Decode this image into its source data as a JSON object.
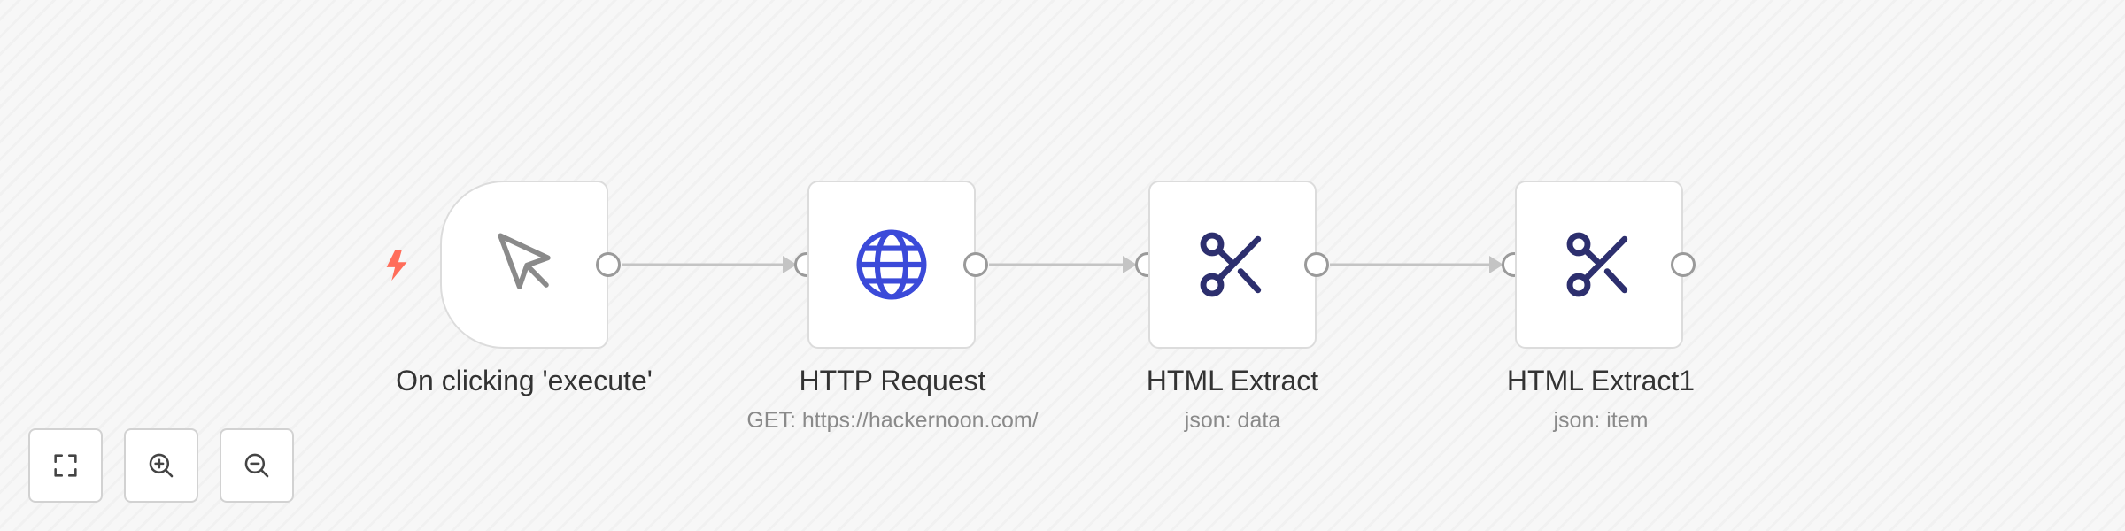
{
  "canvas": {
    "nodes": [
      {
        "title": "On clicking 'execute'",
        "subtitle": "",
        "icon": "cursor-icon",
        "icon_color": "#8a8a8a",
        "trigger_icon": "lightning-icon",
        "trigger_color": "#ff6d5a"
      },
      {
        "title": "HTTP Request",
        "subtitle": "GET: https://hackernoon.com/",
        "icon": "globe-icon",
        "icon_color": "#3b4ad9"
      },
      {
        "title": "HTML Extract",
        "subtitle": "json: data",
        "icon": "scissors-icon",
        "icon_color": "#2d2f6e"
      },
      {
        "title": "HTML Extract1",
        "subtitle": "json: item",
        "icon": "scissors-icon",
        "icon_color": "#2d2f6e"
      }
    ],
    "connection_color": "#c4c4c4"
  },
  "controls": [
    {
      "icon": "fit-to-view-icon"
    },
    {
      "icon": "zoom-in-icon"
    },
    {
      "icon": "zoom-out-icon"
    }
  ]
}
